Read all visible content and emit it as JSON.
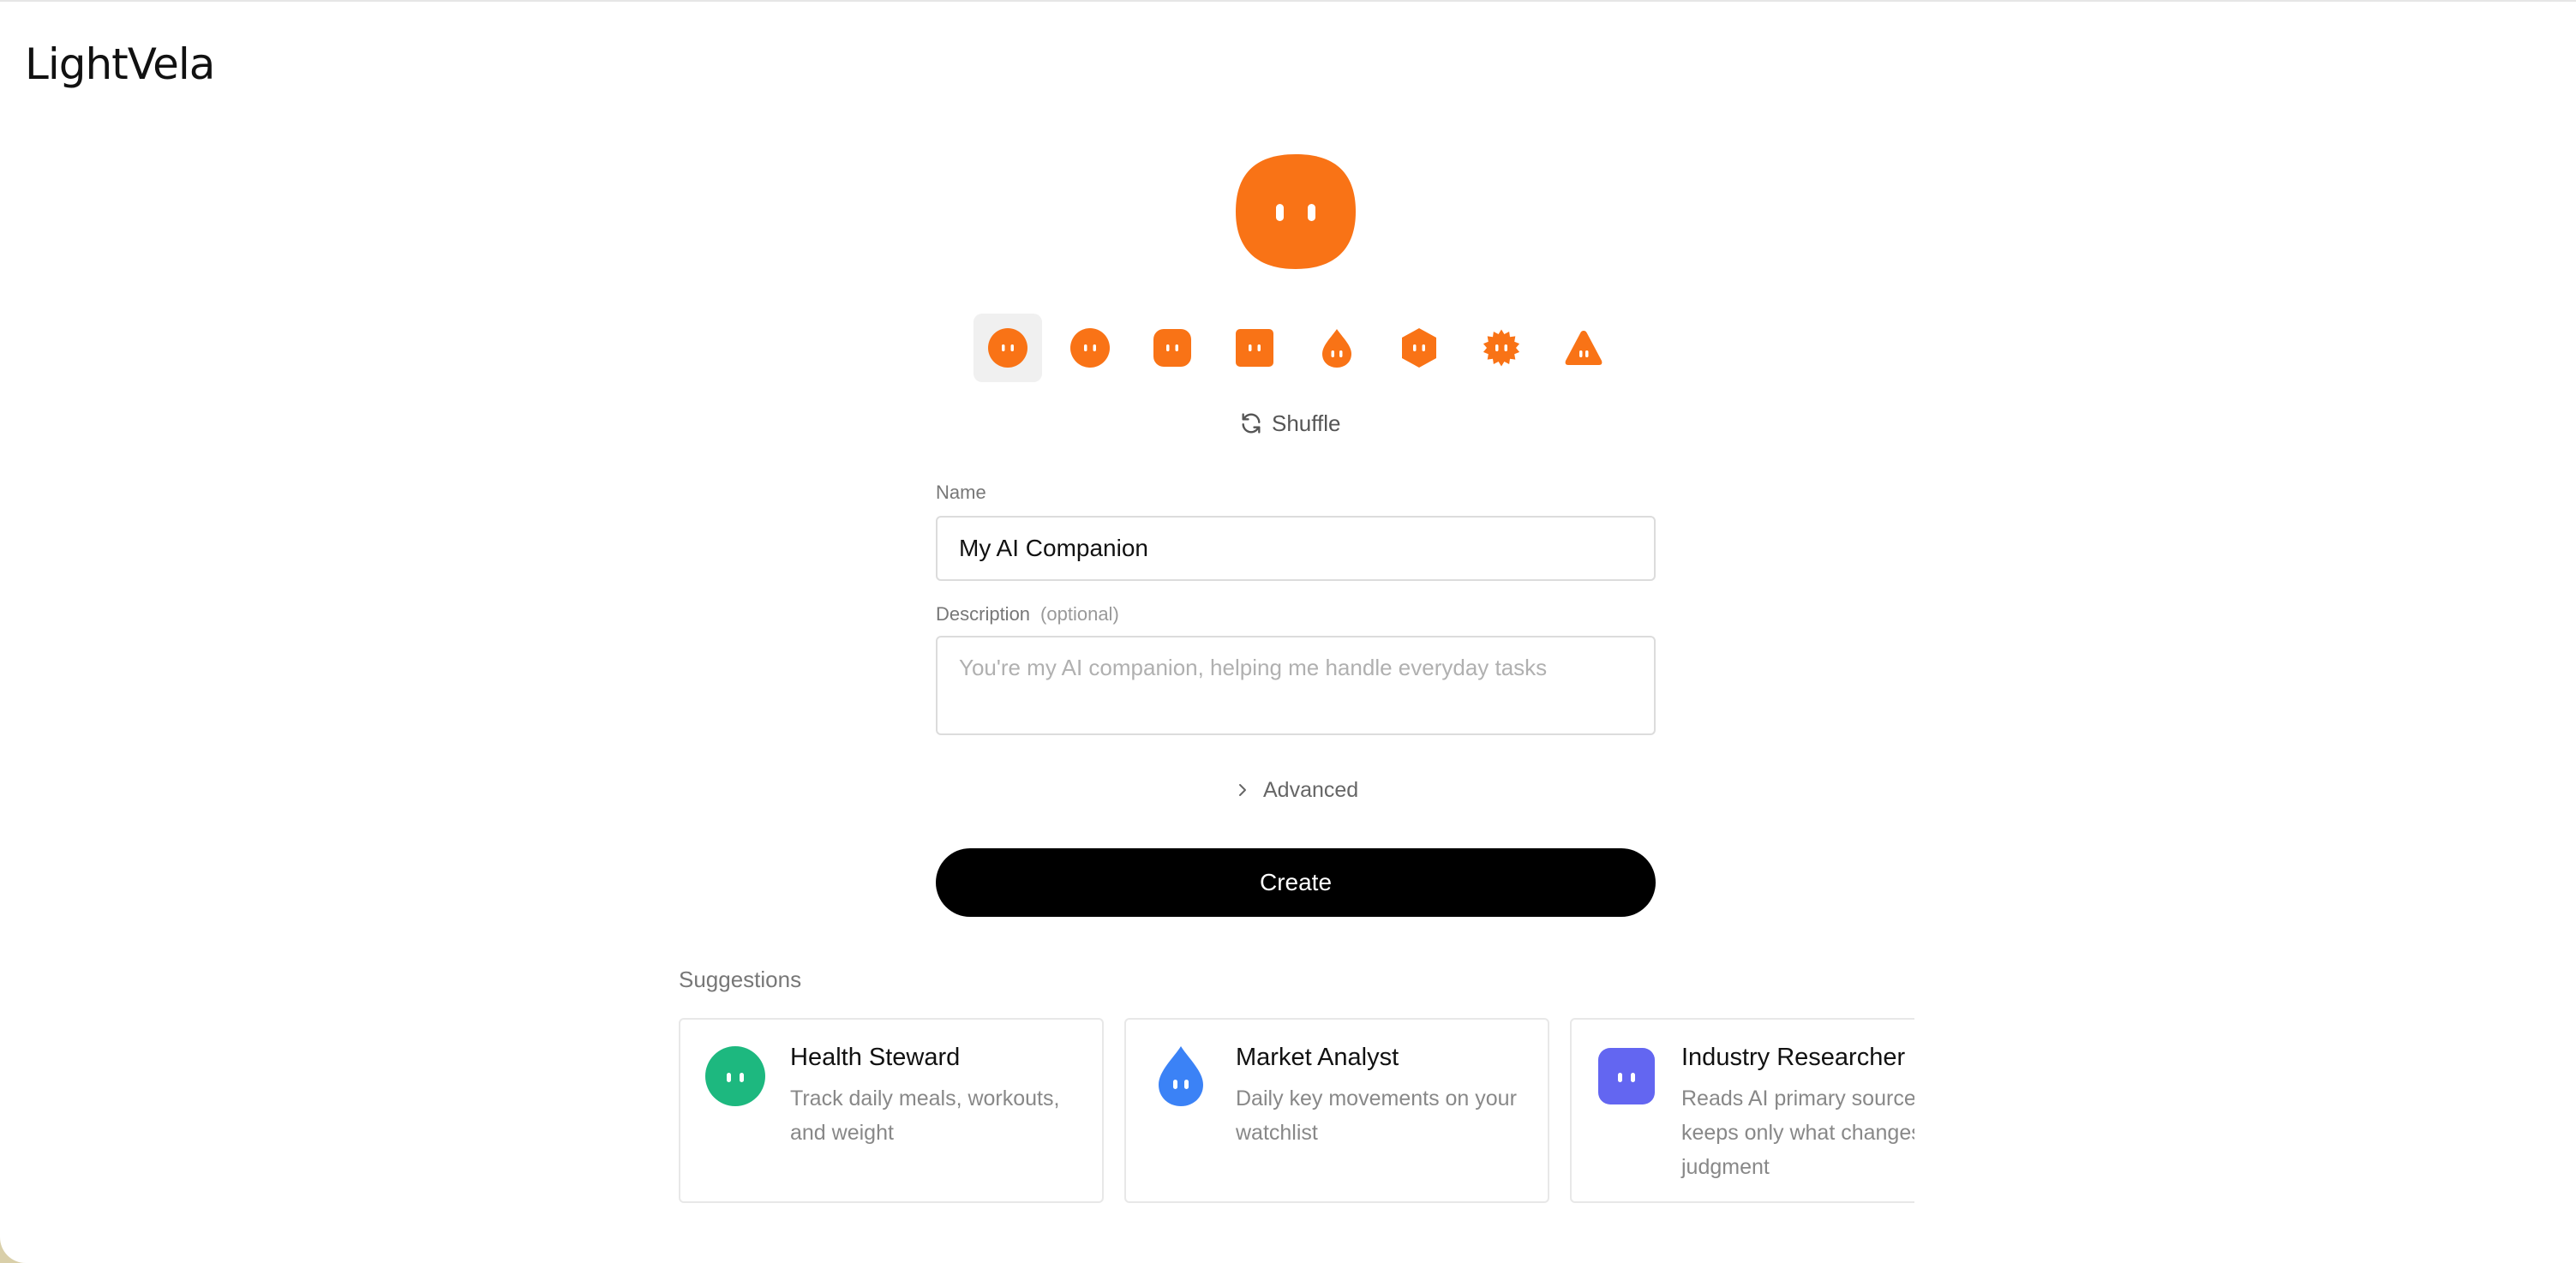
{
  "app": {
    "logo": "LightVela"
  },
  "avatar": {
    "selected_shape": "circle",
    "color": "#F97316",
    "shapes": [
      "circle",
      "circle-small",
      "rounded-square",
      "square",
      "drop",
      "hexagon",
      "gear",
      "triangle"
    ]
  },
  "shuffle": {
    "label": "Shuffle",
    "icon": "refresh-icon"
  },
  "form": {
    "name_label": "Name",
    "name_value": "My AI Companion",
    "description_label": "Description",
    "description_optional": "(optional)",
    "description_placeholder": "You're my AI companion, helping me handle everyday tasks",
    "advanced_label": "Advanced",
    "create_label": "Create"
  },
  "suggestions": {
    "title": "Suggestions",
    "items": [
      {
        "title": "Health Steward",
        "description": "Track daily meals, workouts, and weight",
        "shape": "circle",
        "color": "#1DB87F"
      },
      {
        "title": "Market Analyst",
        "description": "Daily key movements on your watchlist",
        "shape": "drop",
        "color": "#3B82F6"
      },
      {
        "title": "Industry Researcher",
        "description": "Reads AI primary sources daily, keeps only what changes your judgment",
        "shape": "rounded-square",
        "color": "#6366F1"
      }
    ]
  }
}
